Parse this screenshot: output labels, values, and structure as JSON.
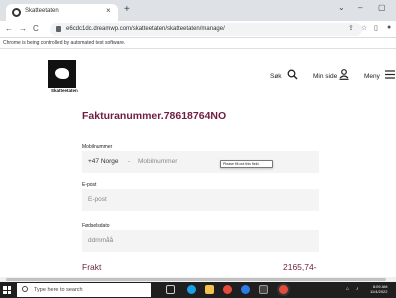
{
  "browser": {
    "tab_title": "Skatteetaten",
    "tab_close": "×",
    "new_tab": "+",
    "url": "e6cdc1dc.dreamwp.com/skatteetaten/skatteetaten/manage/",
    "automation_banner": "Chrome is being controlled by automated test software.",
    "win_min": "–",
    "win_max": "▢",
    "win_chevron": "⌄"
  },
  "header": {
    "logo_text": "Skatteetaten",
    "search_label": "Søk",
    "account_label": "Min side",
    "menu_label": "Meny"
  },
  "form": {
    "title": "Fakturanummer.78618764NO",
    "phone_label": "Mobilnummer",
    "country_code": "+47 Norge",
    "separator": "-",
    "phone_placeholder": "Mobilnummer",
    "validation_tooltip": "Please fill out this field.",
    "email_label": "E-post",
    "email_placeholder": "E-post",
    "dob_label": "Fødselsdato",
    "dob_placeholder": "ddmmåå",
    "shipping_label": "Frakt",
    "shipping_amount": "2165,74-"
  },
  "taskbar": {
    "search_placeholder": "Type here to search",
    "time": "8:09 AM",
    "date": "11/4/2022"
  },
  "colors": {
    "accent": "#6e1d3f",
    "field_bg": "#f4f4f4"
  }
}
